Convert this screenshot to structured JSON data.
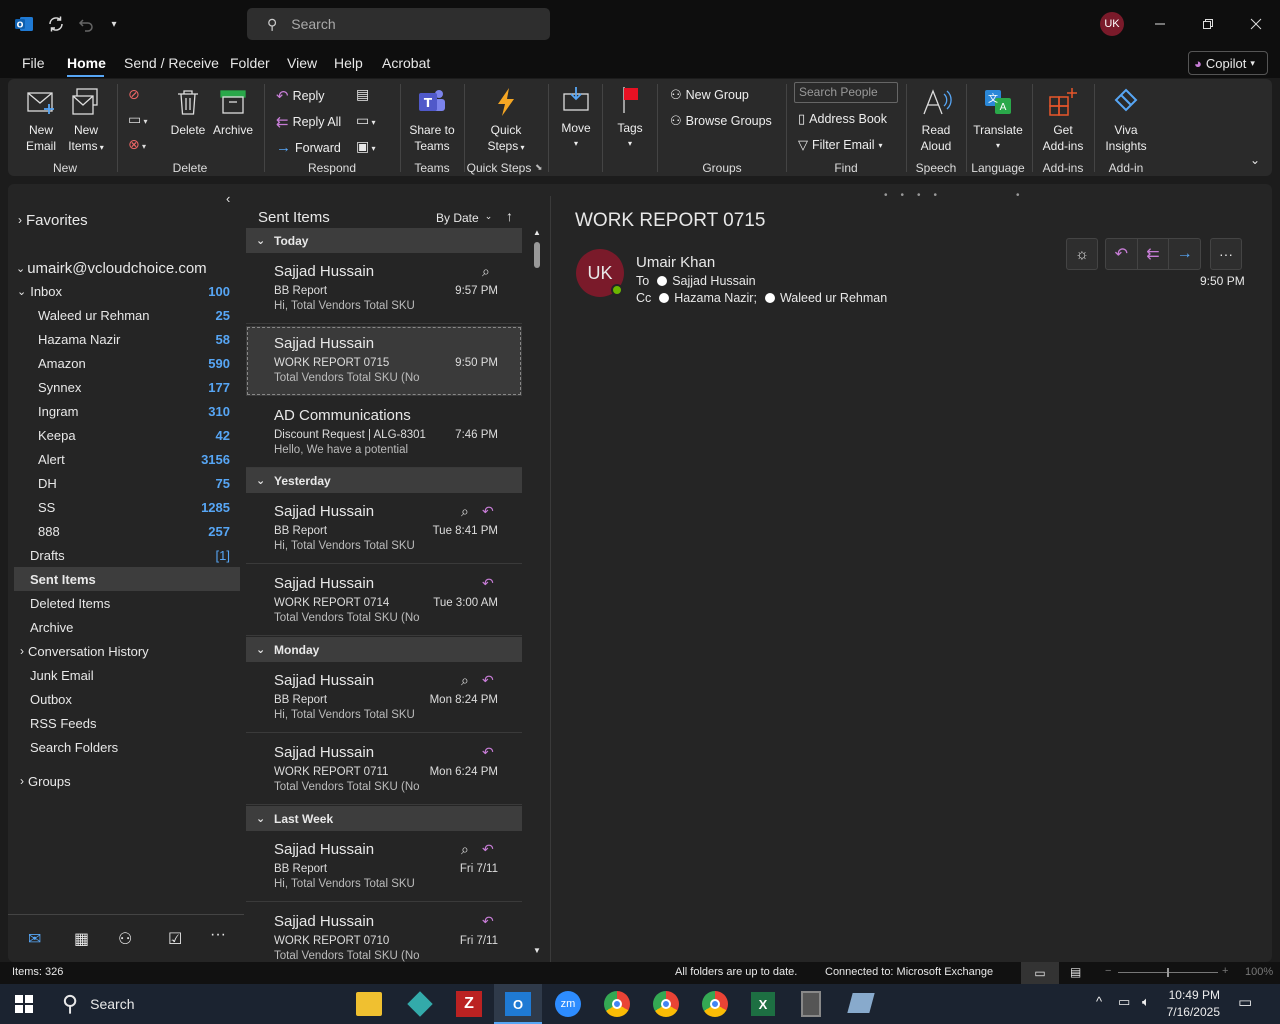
{
  "titlebar": {
    "search_placeholder": "Search",
    "avatar_initials": "UK"
  },
  "menu": {
    "items": [
      "File",
      "Home",
      "Send / Receive",
      "Folder",
      "View",
      "Help",
      "Acrobat"
    ],
    "active": "Home",
    "copilot": "Copilot"
  },
  "ribbon": {
    "new_email": [
      "New",
      "Email"
    ],
    "new_items": [
      "New",
      "Items"
    ],
    "delete": "Delete",
    "archive": "Archive",
    "reply": "Reply",
    "reply_all": "Reply All",
    "forward": "Forward",
    "share_teams": [
      "Share to",
      "Teams"
    ],
    "quick_steps": [
      "Quick",
      "Steps"
    ],
    "move": "Move",
    "tags": "Tags",
    "new_group": "New Group",
    "browse_groups": "Browse Groups",
    "search_people_placeholder": "Search People",
    "address_book": "Address Book",
    "filter_email": "Filter Email",
    "read_aloud": [
      "Read",
      "Aloud"
    ],
    "translate": "Translate",
    "get_addins": [
      "Get",
      "Add-ins"
    ],
    "viva": [
      "Viva",
      "Insights"
    ],
    "groups": [
      "New",
      "Delete",
      "Respond",
      "Teams",
      "Quick Steps",
      "Groups",
      "Find",
      "Speech",
      "Language",
      "Add-ins",
      "Add-in"
    ]
  },
  "nav": {
    "favorites": "Favorites",
    "account": "umairk@vcloudchoice.com",
    "inbox": {
      "label": "Inbox",
      "count": "100"
    },
    "subfolders": [
      {
        "label": "Waleed ur Rehman",
        "count": "25"
      },
      {
        "label": "Hazama Nazir",
        "count": "58"
      },
      {
        "label": "Amazon",
        "count": "590"
      },
      {
        "label": "Synnex",
        "count": "177"
      },
      {
        "label": "Ingram",
        "count": "310"
      },
      {
        "label": "Keepa",
        "count": "42"
      },
      {
        "label": "Alert",
        "count": "3156"
      },
      {
        "label": "DH",
        "count": "75"
      },
      {
        "label": "SS",
        "count": "1285"
      },
      {
        "label": "888",
        "count": "257"
      }
    ],
    "drafts": {
      "label": "Drafts",
      "count": "[1]"
    },
    "folders": [
      "Sent Items",
      "Deleted Items",
      "Archive",
      "Conversation History",
      "Junk Email",
      "Outbox",
      "RSS Feeds",
      "Search Folders"
    ],
    "groups": "Groups"
  },
  "list": {
    "title": "Sent Items",
    "sort": "By Date",
    "groups": [
      "Today",
      "Yesterday",
      "Monday",
      "Last Week"
    ],
    "messages": [
      {
        "from": "Sajjad Hussain",
        "subject": "BB Report",
        "preview": "Hi,  Total Vendors  Total SKU",
        "time": "9:57 PM",
        "attach": true,
        "replied": false
      },
      {
        "from": "Sajjad Hussain",
        "subject": "WORK REPORT 0715",
        "preview": "Total Vendors  Total SKU (No",
        "time": "9:50 PM",
        "attach": false,
        "replied": false
      },
      {
        "from": "AD Communications",
        "subject": "Discount Request | ALG-8301",
        "preview": "Hello,  We have a potential",
        "time": "7:46 PM",
        "attach": false,
        "replied": false
      },
      {
        "from": "Sajjad Hussain",
        "subject": "BB Report",
        "preview": "Hi,  Total Vendors  Total SKU",
        "time": "Tue 8:41 PM",
        "attach": true,
        "replied": true
      },
      {
        "from": "Sajjad Hussain",
        "subject": "WORK REPORT 0714",
        "preview": "Total Vendors  Total SKU (No",
        "time": "Tue 3:00 AM",
        "attach": false,
        "replied": true
      },
      {
        "from": "Sajjad Hussain",
        "subject": "BB Report",
        "preview": "Hi,  Total Vendors  Total SKU",
        "time": "Mon 8:24 PM",
        "attach": true,
        "replied": true
      },
      {
        "from": "Sajjad Hussain",
        "subject": "WORK REPORT 0711",
        "preview": "Total Vendors  Total SKU (No",
        "time": "Mon 6:24 PM",
        "attach": false,
        "replied": true
      },
      {
        "from": "Sajjad Hussain",
        "subject": "BB Report",
        "preview": "Hi,  Total Vendors  Total SKU",
        "time": "Fri 7/11",
        "attach": true,
        "replied": true
      },
      {
        "from": "Sajjad Hussain",
        "subject": "WORK REPORT 0710",
        "preview": "Total Vendors  Total SKU (No",
        "time": "Fri 7/11",
        "attach": false,
        "replied": true
      }
    ]
  },
  "reading": {
    "subject": "WORK REPORT 0715",
    "avatar": "UK",
    "sender": "Umair Khan",
    "to_label": "To",
    "to": "Sajjad Hussain",
    "cc_label": "Cc",
    "cc1": "Hazama Nazir;",
    "cc2": "Waleed ur Rehman",
    "time": "9:50 PM"
  },
  "status": {
    "items": "Items: 326",
    "sync": "All folders are up to date.",
    "connected": "Connected to: Microsoft Exchange",
    "zoom": "100%"
  },
  "taskbar": {
    "search": "Search",
    "time": "10:49 PM",
    "date": "7/16/2025"
  },
  "colors": {
    "accent": "#57a6f5",
    "avatar_bg": "#7a1a2a",
    "reply_purple": "#c77dd6"
  }
}
